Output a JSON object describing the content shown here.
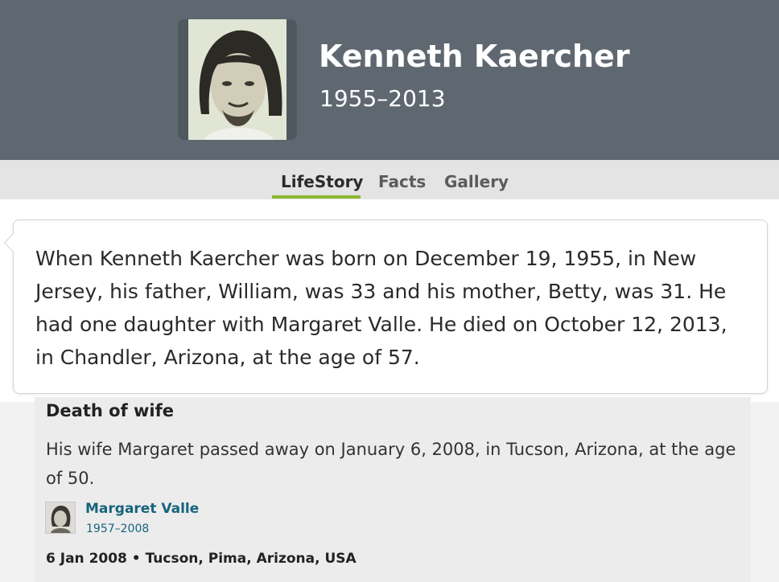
{
  "person": {
    "name": "Kenneth Kaercher",
    "years": "1955–2013"
  },
  "tabs": [
    {
      "label": "LifeStory",
      "active": true
    },
    {
      "label": "Facts",
      "active": false
    },
    {
      "label": "Gallery",
      "active": false
    }
  ],
  "story": {
    "text": "When Kenneth Kaercher was born on December 19, 1955, in New Jersey, his father, William, was 33 and his mother, Betty, was 31. He had one daughter with Margaret Valle. He died on October 12, 2013, in Chandler, Arizona, at the age of 57."
  },
  "event": {
    "title": "Death of wife",
    "description": "His wife Margaret passed away on January 6, 2008, in Tucson, Arizona, at the age of 50.",
    "person_name": "Margaret Valle",
    "person_years": "1957–2008",
    "footer": "6 Jan 2008 • Tucson, Pima, Arizona, USA"
  },
  "colors": {
    "header_bg": "#5f6871",
    "active_tab_underline": "#8cb82e",
    "link": "#17647d"
  }
}
